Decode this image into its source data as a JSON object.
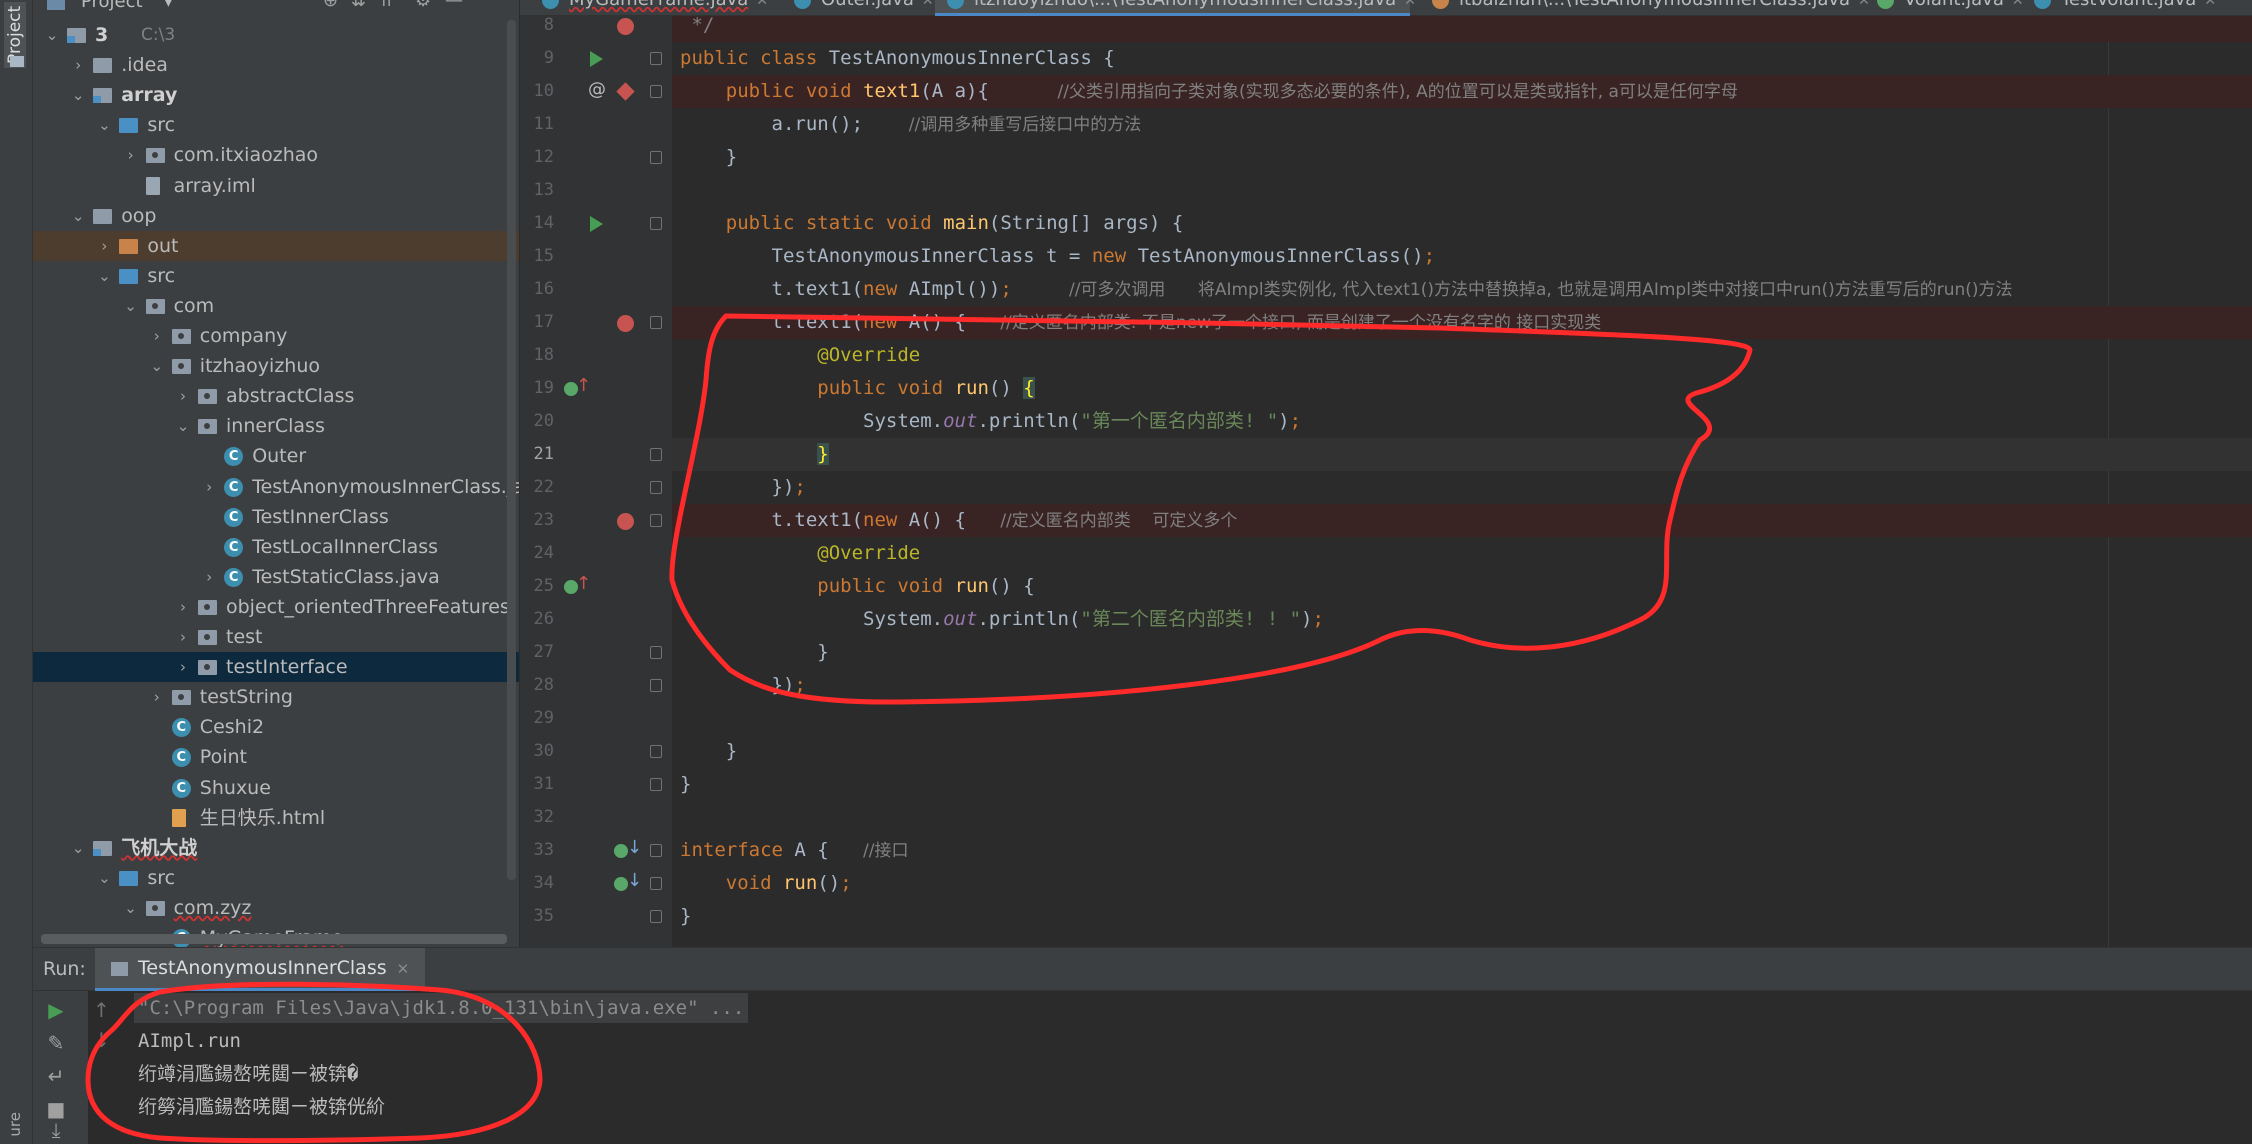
{
  "left_strip": {
    "project_label": "Project",
    "bottom_label": "ure"
  },
  "project_panel": {
    "title": "Project",
    "tree": [
      {
        "label": "3",
        "hint": "C:\\3",
        "depth": 0,
        "arrow": "down",
        "icon": "module",
        "bold": true
      },
      {
        "label": ".idea",
        "depth": 1,
        "arrow": "right",
        "icon": "folder"
      },
      {
        "label": "array",
        "depth": 1,
        "arrow": "down",
        "icon": "module",
        "bold": true
      },
      {
        "label": "src",
        "depth": 2,
        "arrow": "down",
        "icon": "folder-blue"
      },
      {
        "label": "com.itxiaozhao",
        "depth": 3,
        "arrow": "right",
        "icon": "pkg"
      },
      {
        "label": "array.iml",
        "depth": 3,
        "arrow": "",
        "icon": "iml"
      },
      {
        "label": "oop",
        "depth": 1,
        "arrow": "down",
        "icon": "folder"
      },
      {
        "label": "out",
        "depth": 2,
        "arrow": "right",
        "icon": "folder-orange",
        "state": "sel-out"
      },
      {
        "label": "src",
        "depth": 2,
        "arrow": "down",
        "icon": "folder-blue"
      },
      {
        "label": "com",
        "depth": 3,
        "arrow": "down",
        "icon": "pkg"
      },
      {
        "label": "company",
        "depth": 4,
        "arrow": "right",
        "icon": "pkg"
      },
      {
        "label": "itzhaoyizhuo",
        "depth": 4,
        "arrow": "down",
        "icon": "pkg"
      },
      {
        "label": "abstractClass",
        "depth": 5,
        "arrow": "right",
        "icon": "pkg"
      },
      {
        "label": "innerClass",
        "depth": 5,
        "arrow": "down",
        "icon": "pkg"
      },
      {
        "label": "Outer",
        "depth": 6,
        "arrow": "",
        "icon": "cls"
      },
      {
        "label": "TestAnonymousInnerClass.java",
        "depth": 6,
        "arrow": "right",
        "icon": "cls"
      },
      {
        "label": "TestInnerClass",
        "depth": 6,
        "arrow": "",
        "icon": "cls"
      },
      {
        "label": "TestLocalInnerClass",
        "depth": 6,
        "arrow": "",
        "icon": "cls"
      },
      {
        "label": "TestStaticClass.java",
        "depth": 6,
        "arrow": "right",
        "icon": "cls"
      },
      {
        "label": "object_orientedThreeFeatures",
        "depth": 5,
        "arrow": "right",
        "icon": "pkg"
      },
      {
        "label": "test",
        "depth": 5,
        "arrow": "right",
        "icon": "pkg"
      },
      {
        "label": "testInterface",
        "depth": 5,
        "arrow": "right",
        "icon": "pkg",
        "state": "sel"
      },
      {
        "label": "testString",
        "depth": 4,
        "arrow": "right",
        "icon": "pkg"
      },
      {
        "label": "Ceshi2",
        "depth": 4,
        "arrow": "",
        "icon": "cls"
      },
      {
        "label": "Point",
        "depth": 4,
        "arrow": "",
        "icon": "cls"
      },
      {
        "label": "Shuxue",
        "depth": 4,
        "arrow": "",
        "icon": "cls"
      },
      {
        "label": "生日快乐.html",
        "depth": 4,
        "arrow": "",
        "icon": "html"
      },
      {
        "label": "飞机大战",
        "depth": 1,
        "arrow": "down",
        "icon": "module",
        "bold": true,
        "underline": true
      },
      {
        "label": "src",
        "depth": 2,
        "arrow": "down",
        "icon": "folder-blue"
      },
      {
        "label": "com.zyz",
        "depth": 3,
        "arrow": "down",
        "icon": "pkg",
        "underline": true
      },
      {
        "label": "MyGameFrame",
        "depth": 4,
        "arrow": "",
        "icon": "cls",
        "underline": true
      }
    ]
  },
  "tabs": [
    {
      "label": "MyGameFrame.java",
      "icon": "blue",
      "wavy": true
    },
    {
      "label": "Outer.java",
      "icon": "blue"
    },
    {
      "label": "itzhaoyizhuo\\...\\TestAnonymousInnerClass.java",
      "icon": "blue",
      "active": true
    },
    {
      "label": "itbaizhan\\...\\TestAnonymousInnerClass.java",
      "icon": "orange"
    },
    {
      "label": "Volant.java",
      "icon": "green"
    },
    {
      "label": "TestVolant.java",
      "icon": "blue"
    }
  ],
  "editor": {
    "current_line": 21,
    "lines": [
      {
        "n": 8,
        "bp": true,
        "bpline": true,
        "html": "<span class=\"cc\"> */</span>"
      },
      {
        "n": 9,
        "run": true,
        "html": "<span class=\"k\">public class</span> TestAnonymousInnerClass {"
      },
      {
        "n": 10,
        "at": true,
        "bpd": true,
        "bpline": true,
        "html": "    <span class=\"k\">public void</span> <span class=\"f\">text1</span>(A a){      <span class=\"cmt\">//父类引用指向子类对象(实现多态必要的条件), A的位置可以是类或指针, a可以是任何字母</span>"
      },
      {
        "n": 11,
        "html": "        a.run<span class=\"k\"></span>();    <span class=\"cmt\">//调用多种重写后接口中的方法</span>"
      },
      {
        "n": 12,
        "html": "    }"
      },
      {
        "n": 13,
        "html": ""
      },
      {
        "n": 14,
        "run": true,
        "html": "    <span class=\"k\">public static void</span> <span class=\"f\">main</span>(String[] args) {"
      },
      {
        "n": 15,
        "html": "        TestAnonymousInnerClass t = <span class=\"k\">new</span> TestAnonymousInnerClass()<span class=\"k\">;</span>"
      },
      {
        "n": 16,
        "html": "        t.text1(<span class=\"k\">new</span> AImpl())<span class=\"k\">;</span>     <span class=\"cmt\">//可多次调用      将AImpl类实例化, 代入text1()方法中替换掉a, 也就是调用AImpl类中对接口中run()方法重写后的run()方法</span>"
      },
      {
        "n": 17,
        "bp": true,
        "bpline": true,
        "html": "        t.text1(<span class=\"k\">new</span> A() {   <span class=\"cmt\">//定义匿名内部类: 不是new了一个接口, 而是创建了一个没有名字的 接口实现类</span>"
      },
      {
        "n": 18,
        "html": "            <span class=\"ann\">@Override</span>"
      },
      {
        "n": 19,
        "ovr": true,
        "html": "            <span class=\"k\">public void</span> <span class=\"f\">run</span>() <span class=\"braceH\">{</span>"
      },
      {
        "n": 20,
        "html": "                System.<span class=\"st\">out</span>.println(<span class=\"s\">\"第一个匿名内部类! \"</span>)<span class=\"k\">;</span>"
      },
      {
        "n": 21,
        "cur": true,
        "html": "            <span class=\"braceH\">}</span>"
      },
      {
        "n": 22,
        "html": "        })<span class=\"k\">;</span>"
      },
      {
        "n": 23,
        "bp": true,
        "bpline": true,
        "html": "        t.text1(<span class=\"k\">new</span> A() {   <span class=\"cmt\">//定义匿名内部类    可定义多个</span>"
      },
      {
        "n": 24,
        "html": "            <span class=\"ann\">@Override</span>"
      },
      {
        "n": 25,
        "ovr": true,
        "html": "            <span class=\"k\">public void</span> <span class=\"f\">run</span>() {"
      },
      {
        "n": 26,
        "html": "                System.<span class=\"st\">out</span>.println(<span class=\"s\">\"第二个匿名内部类! ! \"</span>)<span class=\"k\">;</span>"
      },
      {
        "n": 27,
        "html": "            }"
      },
      {
        "n": 28,
        "html": "        })<span class=\"k\">;</span>"
      },
      {
        "n": 29,
        "html": ""
      },
      {
        "n": 30,
        "html": "    }"
      },
      {
        "n": 31,
        "html": "}"
      },
      {
        "n": 32,
        "html": ""
      },
      {
        "n": 33,
        "impl": true,
        "html": "<span class=\"k\">interface</span> A {   <span class=\"cmt\">//接口</span>"
      },
      {
        "n": 34,
        "impl": true,
        "html": "    <span class=\"k\">void</span> <span class=\"f\">run</span>()<span class=\"k\">;</span>"
      },
      {
        "n": 35,
        "html": "}"
      }
    ]
  },
  "run_panel": {
    "label": "Run:",
    "tab": "TestAnonymousInnerClass",
    "console": [
      "\"C:\\Program Files\\Java\\jdk1.8.0_131\\bin\\java.exe\" ...",
      "AImpl.run",
      "绗竴涓尶鍚嶅唴閮ㄧ被锛�",
      "绗簩涓尶鍚嶅唴閮ㄧ被锛侊紒"
    ]
  },
  "colors": {
    "annotation_red": "#ff2a2a",
    "accent": "#4a88c7",
    "breakpoint": "#c75450"
  }
}
